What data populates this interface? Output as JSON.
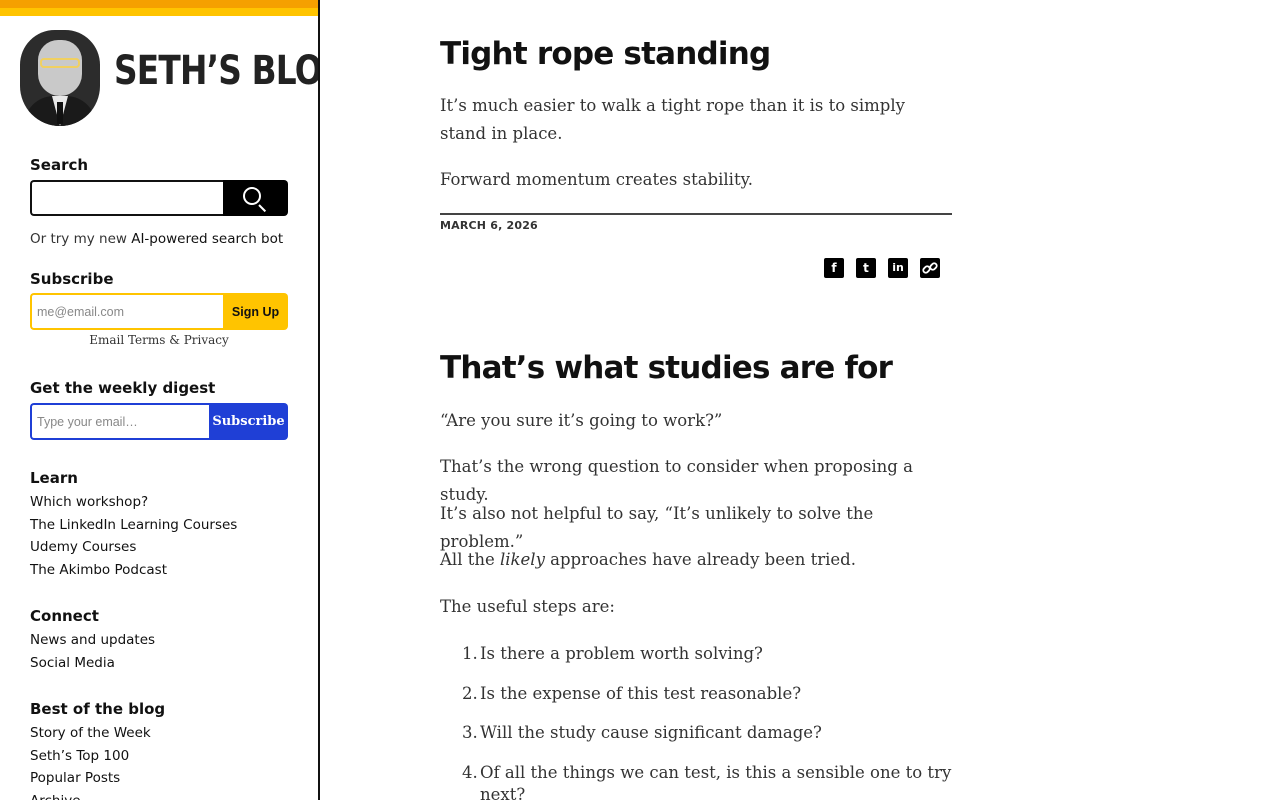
{
  "sidebar": {
    "brand_title": "SETH’S BLOG",
    "search": {
      "label": "Search",
      "placeholder": ""
    },
    "or_try": {
      "prefix": "Or try my new ",
      "link": "AI-powered search bot"
    },
    "subscribe": {
      "label": "Subscribe",
      "placeholder": "me@email.com",
      "button": "Sign Up",
      "terms": "Email Terms & Privacy"
    },
    "digest": {
      "label": "Get the weekly digest",
      "placeholder": "Type your email…",
      "button": "Subscribe"
    },
    "learn": {
      "label": "Learn",
      "items": [
        "Which workshop?",
        "The LinkedIn Learning Courses",
        "Udemy Courses",
        "The Akimbo Podcast"
      ]
    },
    "connect": {
      "label": "Connect",
      "items": [
        "News and updates",
        "Social Media"
      ]
    },
    "best": {
      "label": "Best of the blog",
      "items": [
        "Story of the Week",
        "Seth’s Top 100",
        "Popular Posts",
        "Archive"
      ]
    }
  },
  "posts": [
    {
      "title": "Tight rope standing",
      "paragraphs": [
        "It’s much easier to walk a tight rope than it is to simply stand in place.",
        "Forward momentum creates stability."
      ],
      "date": "MARCH 6, 2026",
      "share_icons": [
        "facebook-icon",
        "twitter-icon",
        "linkedin-icon",
        "link-icon"
      ]
    },
    {
      "title": "That’s what studies are for",
      "paragraphs": [
        "“Are you sure it’s going to work?”",
        "That’s the wrong question to consider when proposing a study.",
        "It’s also not helpful to say, “It’s unlikely to solve the problem.”"
      ],
      "likely_line": {
        "before": "All the ",
        "em": "likely",
        "after": " approaches have already been tried."
      },
      "steps_intro": "The useful steps are:",
      "steps": [
        "Is there a problem worth solving?",
        "Is the expense of this test reasonable?",
        "Will the study cause significant damage?",
        "Of all the things we can test, is this a sensible one to try next?"
      ]
    }
  ],
  "colors": {
    "accent_orange": "#f5a000",
    "accent_yellow": "#ffc400",
    "digest_blue": "#1f3fd6"
  }
}
